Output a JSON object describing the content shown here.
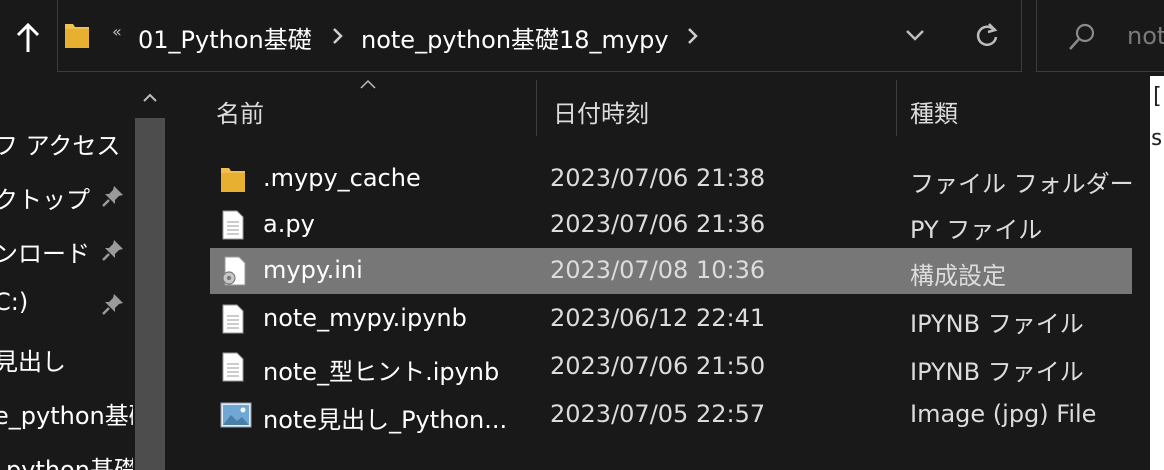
{
  "window": {
    "up_icon": "up-arrow-icon"
  },
  "address_bar": {
    "overflow_glyph": "«",
    "crumbs": [
      "01_Python基礎",
      "note_python基礎18_mypy"
    ],
    "separator_icon": "chevron-right-icon",
    "dropdown_icon": "chevron-down-icon",
    "refresh_icon": "refresh-icon"
  },
  "search": {
    "placeholder_visible": "not",
    "icon": "search-icon"
  },
  "nav_pane": {
    "items": [
      {
        "label": "フ アクセス",
        "pinned": false
      },
      {
        "label": "クトップ",
        "pinned": true
      },
      {
        "label": "ンロード",
        "pinned": true
      },
      {
        "label": "C:)",
        "pinned": true
      },
      {
        "label": "見出し",
        "pinned": false
      },
      {
        "label": "e_python基礎",
        "pinned": false
      },
      {
        "label": "_python基礎",
        "pinned": false
      }
    ]
  },
  "columns": {
    "name": "名前",
    "date": "日付時刻",
    "type": "種類"
  },
  "files": [
    {
      "name": ".mypy_cache",
      "date": "2023/07/06 21:38",
      "type": "ファイル フォルダー",
      "icon": "folder-icon",
      "selected": false
    },
    {
      "name": "a.py",
      "date": "2023/07/06 21:36",
      "type": "PY ファイル",
      "icon": "file-icon",
      "selected": false
    },
    {
      "name": "mypy.ini",
      "date": "2023/07/08 10:36",
      "type": "構成設定",
      "icon": "settings-file-icon",
      "selected": true
    },
    {
      "name": "note_mypy.ipynb",
      "date": "2023/06/12 22:41",
      "type": "IPYNB ファイル",
      "icon": "file-icon",
      "selected": false
    },
    {
      "name": "note_型ヒント.ipynb",
      "date": "2023/07/06 21:50",
      "type": "IPYNB ファイル",
      "icon": "file-icon",
      "selected": false
    },
    {
      "name": "note見出し_Python...",
      "date": "2023/07/05 22:57",
      "type": "Image (jpg) File",
      "icon": "image-file-icon",
      "selected": false
    }
  ],
  "preview": {
    "chars": [
      "[",
      "s"
    ]
  },
  "colors": {
    "background": "#191919",
    "selected_row": "#777777",
    "folder": "#f2c04c"
  }
}
